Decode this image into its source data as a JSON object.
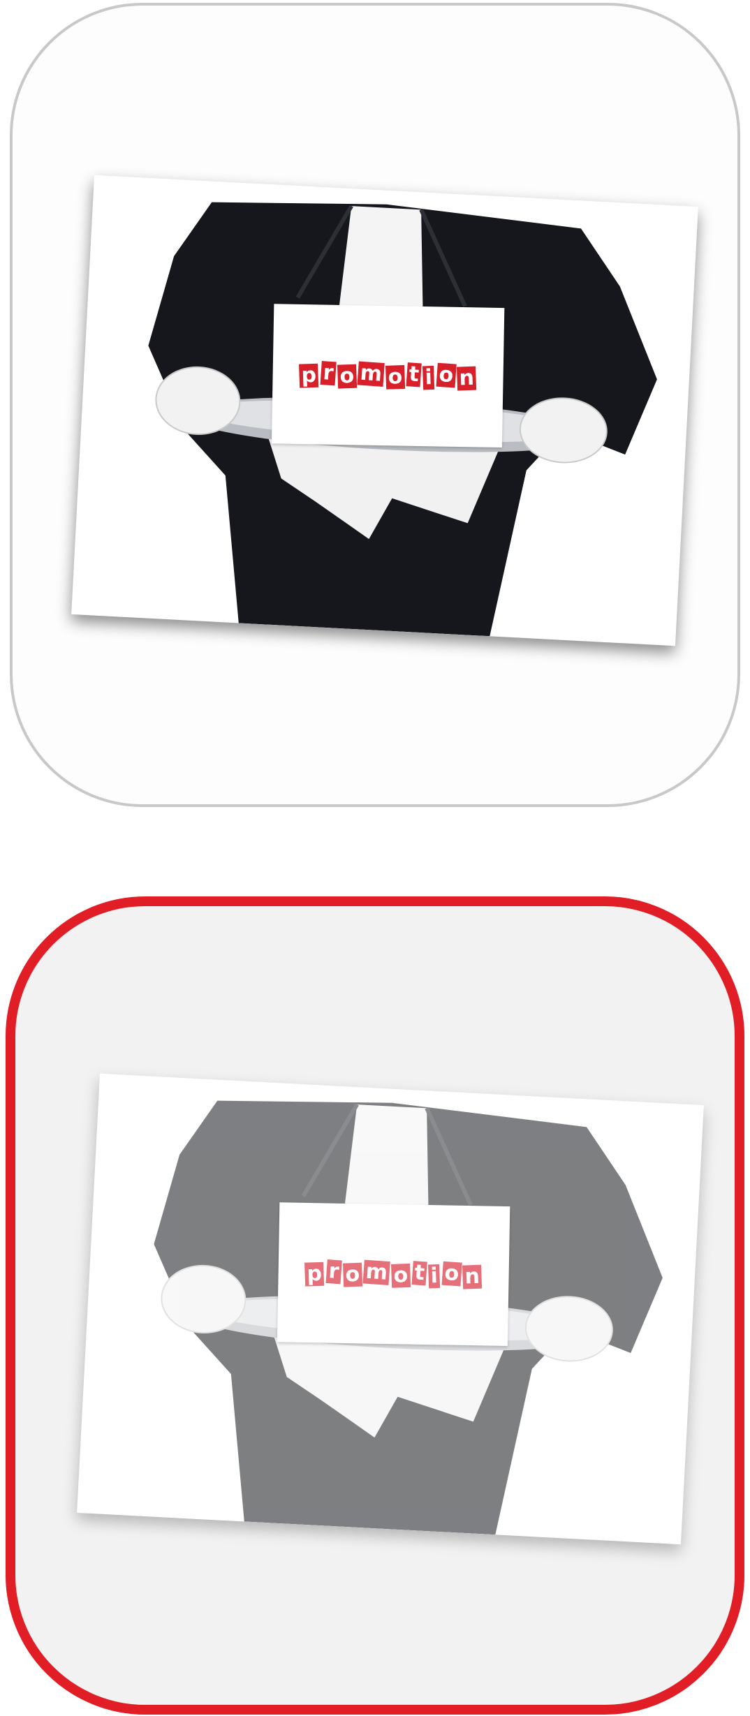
{
  "tiles": [
    {
      "state": "default",
      "image_icon": "promotion-butler-icon",
      "sign_text": "promotion",
      "border_color": "#c8c8c8"
    },
    {
      "state": "selected",
      "image_icon": "promotion-butler-icon",
      "sign_text": "promotion",
      "border_color": "#e11d26"
    }
  ],
  "colors": {
    "accent": "#e11d26",
    "sign_letters": "#d7202a"
  }
}
